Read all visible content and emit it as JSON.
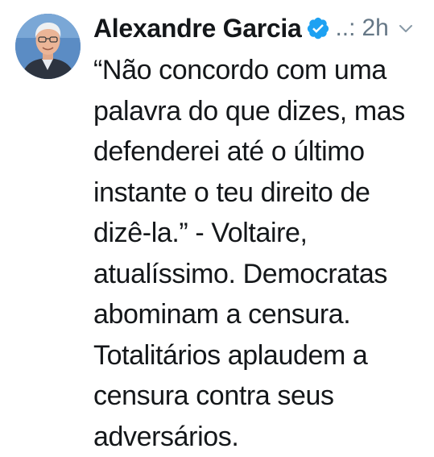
{
  "tweet": {
    "author_name": "Alexandre Garcia",
    "handle_truncated": "..:",
    "time": "2h",
    "verified": true,
    "text_lines": [
      "“Não concordo com uma",
      "palavra do que dizes, mas",
      "defenderei até o último",
      "instante o teu direito de",
      "dizê-la.” - Voltaire,",
      "atualíssimo. Democratas",
      "abominam a censura.",
      "Totalitários aplaudem a",
      "censura contra seus",
      "adversários."
    ]
  },
  "icons": {
    "verified": "verified-badge-icon",
    "chevron": "chevron-down-icon",
    "avatar": "avatar"
  },
  "colors": {
    "text": "#14171a",
    "secondary": "#657786",
    "verified_blue": "#1da1f2"
  }
}
